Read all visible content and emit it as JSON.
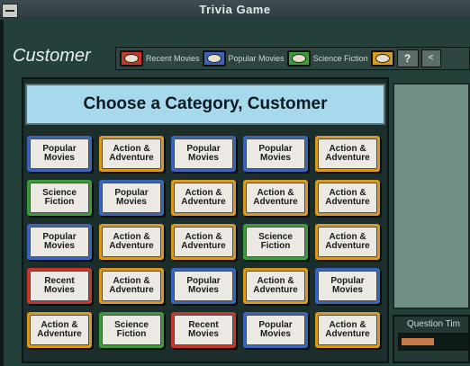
{
  "window": {
    "title": "Trivia Game"
  },
  "player": {
    "name": "Customer"
  },
  "legend": [
    {
      "label": "Recent Movies",
      "color": "#c4382c"
    },
    {
      "label": "Popular Movies",
      "color": "#3a64b8"
    },
    {
      "label": "Science Fiction",
      "color": "#3c9a3a"
    },
    {
      "label": "",
      "color": "#d79a1e"
    }
  ],
  "buttons": {
    "help": "?",
    "next": "<"
  },
  "banner": {
    "text": "Choose a Category, Customer"
  },
  "tiles": [
    {
      "label": "Popular Movies",
      "kind": "popular"
    },
    {
      "label": "Action & Adventure",
      "kind": "action"
    },
    {
      "label": "Popular Movies",
      "kind": "popular"
    },
    {
      "label": "Popular Movies",
      "kind": "popular"
    },
    {
      "label": "Action & Adventure",
      "kind": "action"
    },
    {
      "label": "Science Fiction",
      "kind": "science"
    },
    {
      "label": "Popular Movies",
      "kind": "popular"
    },
    {
      "label": "Action & Adventure",
      "kind": "action"
    },
    {
      "label": "Action & Adventure",
      "kind": "action"
    },
    {
      "label": "Action & Adventure",
      "kind": "action"
    },
    {
      "label": "Popular Movies",
      "kind": "popular"
    },
    {
      "label": "Action & Adventure",
      "kind": "action"
    },
    {
      "label": "Action & Adventure",
      "kind": "action"
    },
    {
      "label": "Science Fiction",
      "kind": "science"
    },
    {
      "label": "Action & Adventure",
      "kind": "action"
    },
    {
      "label": "Recent Movies",
      "kind": "recent"
    },
    {
      "label": "Action & Adventure",
      "kind": "action"
    },
    {
      "label": "Popular Movies",
      "kind": "popular"
    },
    {
      "label": "Action & Adventure",
      "kind": "action"
    },
    {
      "label": "Popular Movies",
      "kind": "popular"
    },
    {
      "label": "Action & Adventure",
      "kind": "action"
    },
    {
      "label": "Science Fiction",
      "kind": "science"
    },
    {
      "label": "Recent Movies",
      "kind": "recent"
    },
    {
      "label": "Popular Movies",
      "kind": "popular"
    },
    {
      "label": "Action & Adventure",
      "kind": "action"
    }
  ],
  "timer": {
    "label": "Question Tim",
    "remaining_fraction": 0.5
  }
}
